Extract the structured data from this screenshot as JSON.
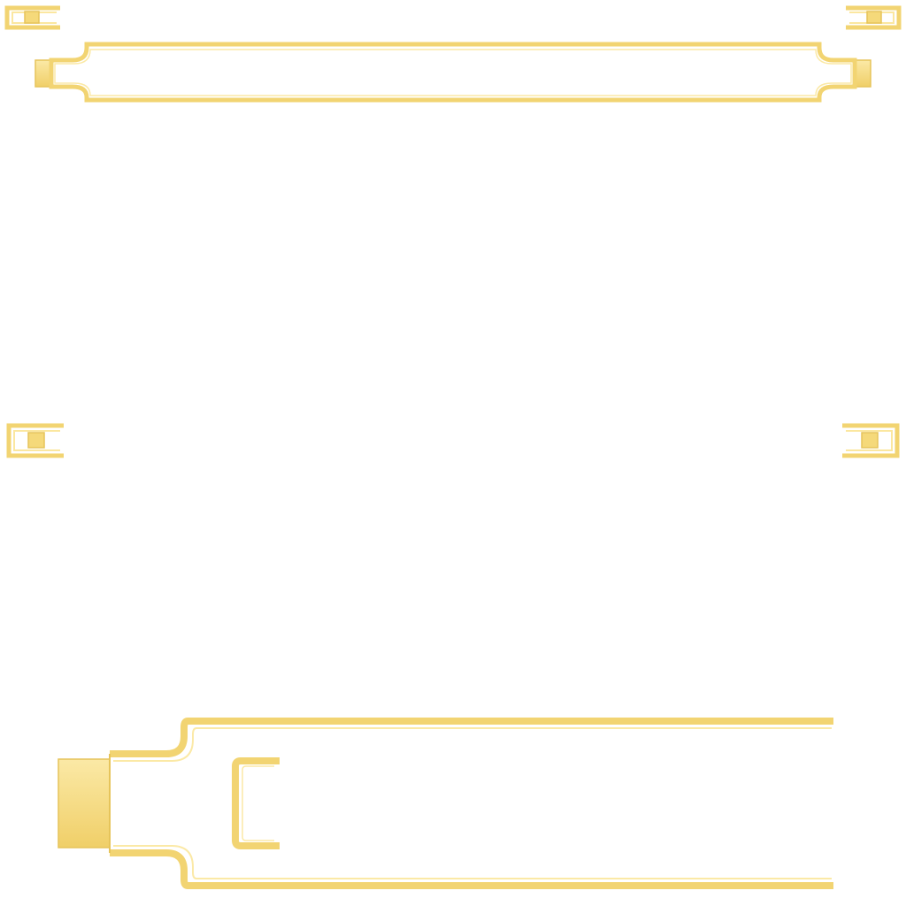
{
  "sheet": {
    "description_free": true,
    "background": "#ffffff"
  },
  "colors": {
    "gold": "#f5d97a",
    "gold_edge": "#e6c45a",
    "gold_light": "#fbe9a6"
  },
  "pieces": {
    "corner_brackets": [
      "bracket-top-left",
      "bracket-top-right",
      "bracket-mid-left",
      "bracket-mid-right"
    ],
    "title_bar": "title-bar-frame",
    "large_panel": "large-panel-frame",
    "tab_block": "tab-block",
    "inner_bracket": "inner-c-bracket"
  }
}
